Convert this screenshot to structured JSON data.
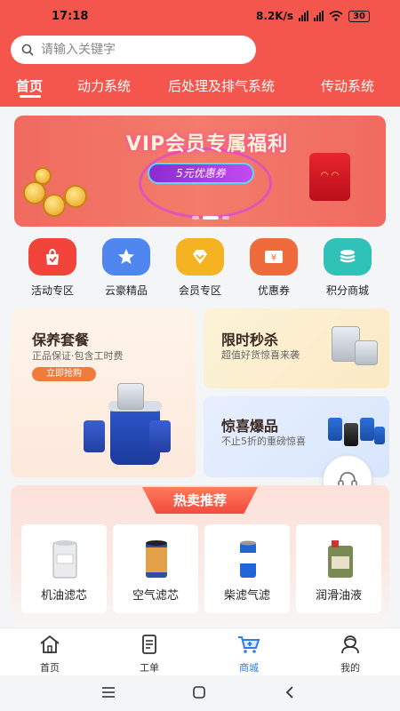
{
  "status_bar": {
    "time": "17:18",
    "net_speed": "8.2K/s",
    "battery": "30"
  },
  "search": {
    "placeholder": "请输入关键字"
  },
  "tabs": [
    {
      "label": "首页",
      "active": true
    },
    {
      "label": "动力系统"
    },
    {
      "label": "后处理及排气系统"
    },
    {
      "label": "传动系统"
    }
  ],
  "banner": {
    "title": "VIP会员专属福利",
    "coupon": "5元优惠券"
  },
  "quick_menu": [
    {
      "label": "活动专区",
      "icon": "bag-icon",
      "color": "#f2443a"
    },
    {
      "label": "云豪精品",
      "icon": "star-icon",
      "color": "#4f86f0"
    },
    {
      "label": "会员专区",
      "icon": "diamond-icon",
      "color": "#f5b324"
    },
    {
      "label": "优惠券",
      "icon": "coupon-icon",
      "color": "#f06b3c"
    },
    {
      "label": "积分商城",
      "icon": "coins-icon",
      "color": "#30c2b6"
    }
  ],
  "promo": {
    "main": {
      "title": "保养套餐",
      "subtitle": "正品保证·包含工时费",
      "button": "立即抢购"
    },
    "flash": {
      "title": "限时秒杀",
      "subtitle": "超值好货惊喜来袭"
    },
    "surprise": {
      "title": "惊喜爆品",
      "subtitle": "不止5折的重磅惊喜"
    }
  },
  "hot": {
    "title": "热卖推荐",
    "products": [
      {
        "label": "机油滤芯"
      },
      {
        "label": "空气滤芯"
      },
      {
        "label": "柴滤气滤"
      },
      {
        "label": "润滑油液"
      }
    ]
  },
  "bottom_nav": [
    {
      "label": "首页",
      "icon": "home-icon"
    },
    {
      "label": "工单",
      "icon": "order-icon"
    },
    {
      "label": "商城",
      "icon": "cart-icon",
      "active": true
    },
    {
      "label": "我的",
      "icon": "profile-icon"
    }
  ],
  "colors": {
    "brand_red": "#f4554d",
    "active_blue": "#2b7de9"
  }
}
